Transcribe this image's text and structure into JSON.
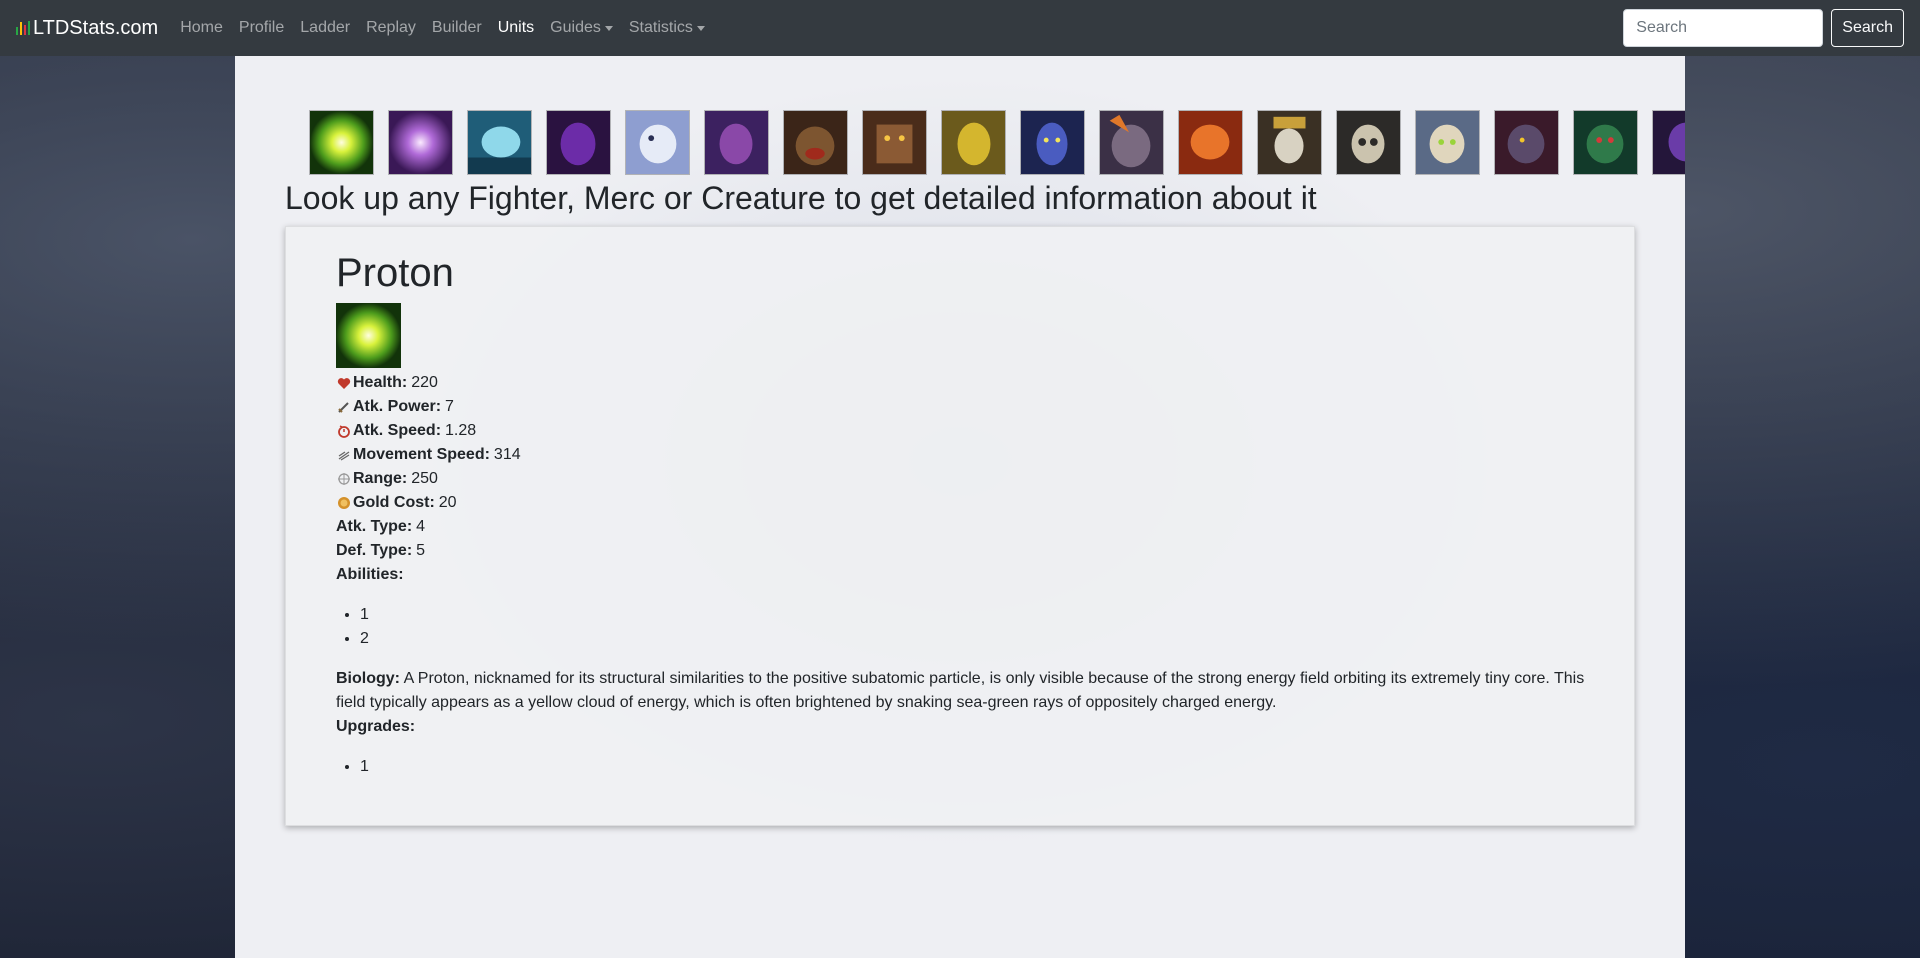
{
  "brand": {
    "name": "LTDStats.com",
    "icon": "bar-chart-icon"
  },
  "nav": {
    "home": "Home",
    "profile": "Profile",
    "ladder": "Ladder",
    "replay": "Replay",
    "builder": "Builder",
    "units": "Units",
    "guides": "Guides",
    "statistics": "Statistics"
  },
  "search": {
    "placeholder": "Search",
    "value": "",
    "button": "Search"
  },
  "headline": "Look up any Fighter, Merc or Creature to get detailed information about it",
  "unit": {
    "name": "Proton",
    "stats": {
      "health": {
        "label": "Health:",
        "value": "220"
      },
      "atk_power": {
        "label": "Atk. Power:",
        "value": "7"
      },
      "atk_speed": {
        "label": "Atk. Speed:",
        "value": "1.28"
      },
      "move_speed": {
        "label": "Movement Speed:",
        "value": "314"
      },
      "range": {
        "label": "Range:",
        "value": "250"
      },
      "gold_cost": {
        "label": "Gold Cost:",
        "value": "20"
      },
      "atk_type": {
        "label": "Atk. Type:",
        "value": "4"
      },
      "def_type": {
        "label": "Def. Type:",
        "value": "5"
      }
    },
    "abilities_label": "Abilities:",
    "abilities": [
      "1",
      "2"
    ],
    "biology_label": "Biology:",
    "biology": "A Proton, nicknamed for its structural similarities to the positive subatomic particle, is only visible because of the strong energy field orbiting its extremely tiny core. This field typically appears as a yellow cloud of energy, which is often brightened by snaking sea-green rays of oppositely charged energy.",
    "upgrades_label": "Upgrades:",
    "upgrades": [
      "1"
    ]
  },
  "colors": {
    "navbar": "#343a40",
    "brand_bar_green": "#28a745",
    "brand_bar_yellow": "#ffc107",
    "brand_bar_red": "#dc3545",
    "health_icon": "#c0392b",
    "gold_icon": "#d4912a"
  }
}
